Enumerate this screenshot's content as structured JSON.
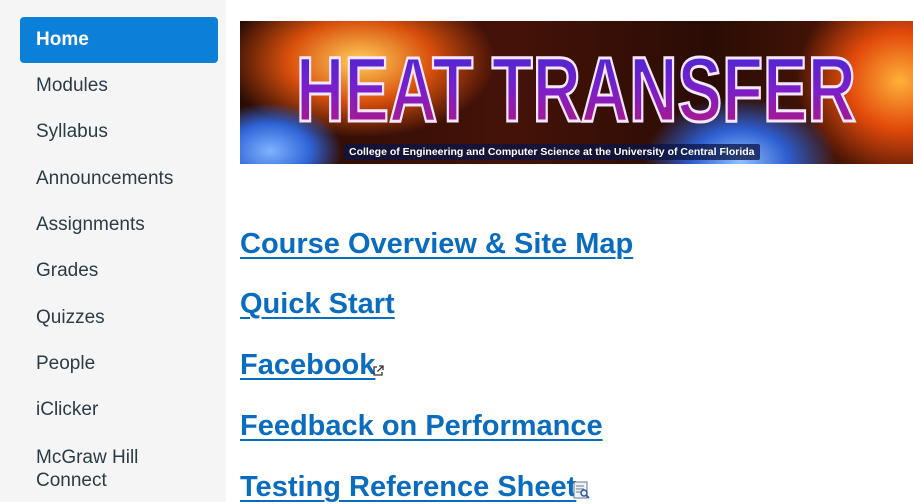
{
  "sidebar": {
    "items": [
      {
        "label": "Home",
        "active": true
      },
      {
        "label": "Modules"
      },
      {
        "label": "Syllabus"
      },
      {
        "label": "Announcements"
      },
      {
        "label": "Assignments"
      },
      {
        "label": "Grades"
      },
      {
        "label": "Quizzes"
      },
      {
        "label": "People"
      },
      {
        "label": "iClicker"
      },
      {
        "label": "McGraw Hill\nConnect"
      }
    ]
  },
  "banner": {
    "title": "HEAT TRANSFER",
    "subtitle": "College of Engineering and Computer Science at the University of Central Florida"
  },
  "links": [
    {
      "label": "Course Overview & Site Map"
    },
    {
      "label": "Quick Start"
    },
    {
      "label": "Facebook",
      "icon": "external-link-icon"
    },
    {
      "label": "Feedback on Performance"
    },
    {
      "label": "Testing Reference Sheet",
      "icon": "document-preview-icon"
    }
  ],
  "colors": {
    "accent": "#0c7fd8",
    "link": "#0a6cbf",
    "sidebar_bg": "#f5f5f5",
    "nav_text": "#2d3b45"
  }
}
